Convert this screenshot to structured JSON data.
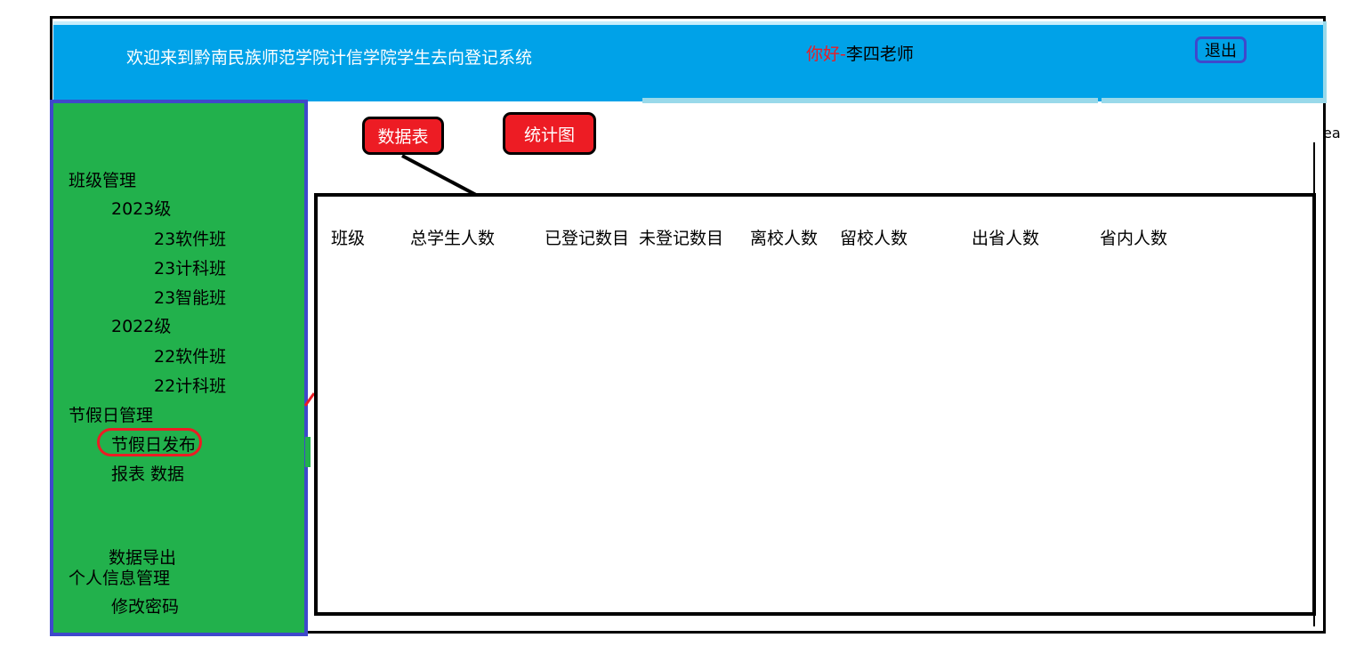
{
  "header": {
    "welcome": "欢迎来到黔南民族师范学院计信学院学生去向登记系统",
    "greeting_hello": "你好",
    "greeting_dash": "-",
    "greeting_name": "李四老师",
    "logout_label": "退出"
  },
  "sidebar": {
    "class_mgmt": "班级管理",
    "grade_2023": "2023级",
    "class_23_software": "23软件班",
    "class_23_cs": "23计科班",
    "class_23_ai": "23智能班",
    "grade_2022": "2022级",
    "class_22_software": "22软件班",
    "class_22_cs": "22计科班",
    "holiday_mgmt": "节假日管理",
    "holiday_publish": "节假日发布",
    "report_data": "报表 数据",
    "data_export": "数据导出",
    "personal_info_mgmt": "个人信息管理",
    "change_password": "修改密码"
  },
  "tabs": {
    "datatable": "数据表",
    "chart": "统计图"
  },
  "table": {
    "columns": [
      "班级",
      "总学生人数",
      "已登记数目",
      "未登记数目",
      "离校人数",
      "留校人数",
      "出省人数",
      "省内人数"
    ]
  },
  "fragment": {
    "right_text": "ea"
  },
  "colors": {
    "header_bg": "#00a2e8",
    "sidebar_bg": "#22b14c",
    "sidebar_border": "#3f48cc",
    "accent_red": "#ed1c24"
  }
}
